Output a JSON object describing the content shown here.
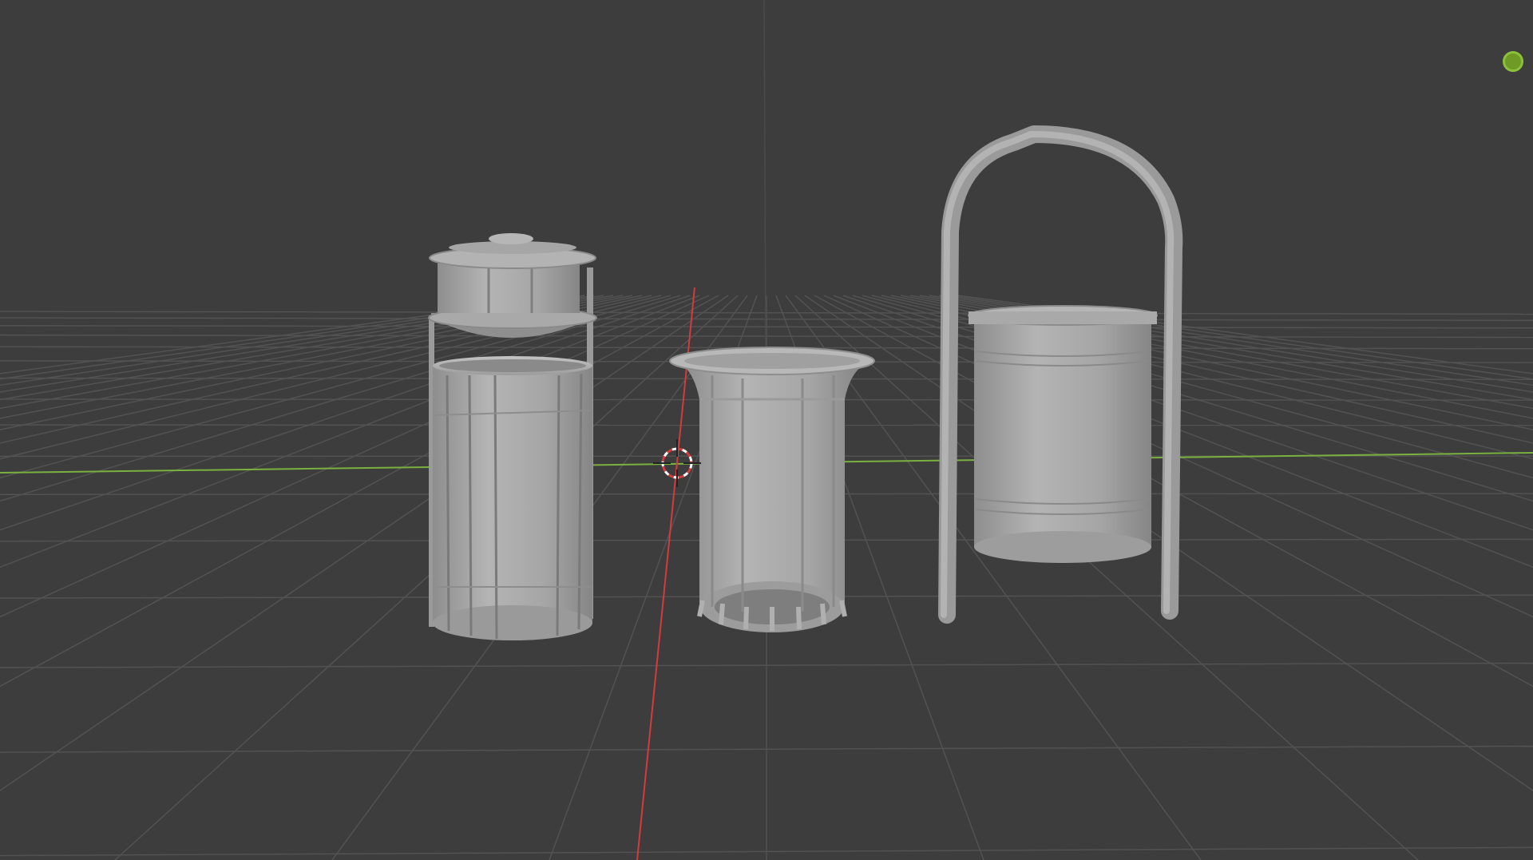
{
  "viewport": {
    "mode": "3D Viewport",
    "shading": "solid",
    "background": "#3d3d3d",
    "grid_color": "#555555",
    "x_axis_color": "#d23c3c",
    "y_axis_color": "#7ab040",
    "mesh_color": "#a8a8a8"
  },
  "scene_objects": [
    {
      "name": "trash-bin-with-lid",
      "icon": "cylinder-mesh"
    },
    {
      "name": "trash-bin-flared-slats",
      "icon": "cylinder-mesh"
    },
    {
      "name": "hanging-trash-bin-with-arch",
      "icon": "cylinder-mesh"
    }
  ],
  "overlays": {
    "gizmo_indicator_color": "#8ac03a",
    "cursor_icon": "3d-cursor-icon"
  }
}
